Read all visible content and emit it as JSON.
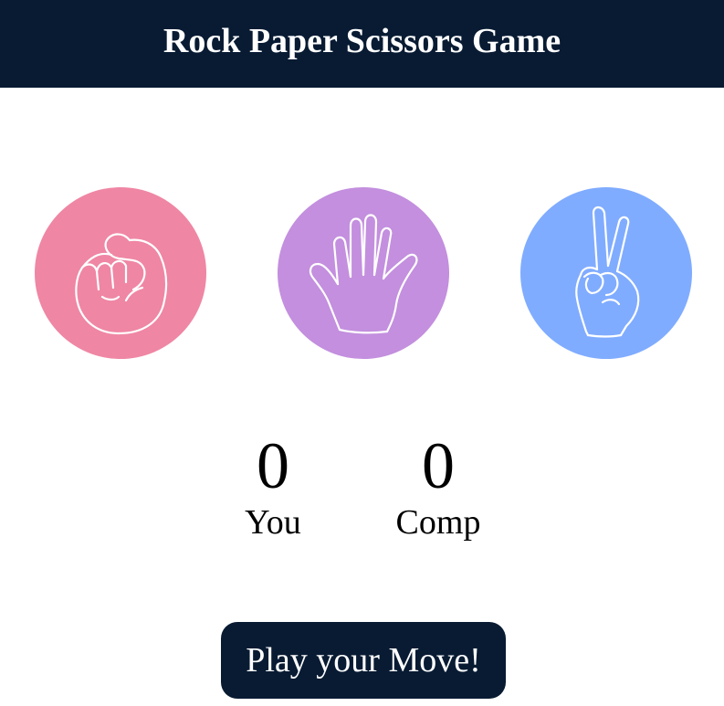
{
  "header": {
    "title": "Rock Paper Scissors Game"
  },
  "choices": [
    {
      "id": "rock",
      "icon": "fist-icon",
      "color": "#ef86a4"
    },
    {
      "id": "paper",
      "icon": "open-hand-icon",
      "color": "#c38fde"
    },
    {
      "id": "scissors",
      "icon": "peace-sign-icon",
      "color": "#80acff"
    }
  ],
  "scoreboard": {
    "user_score": "0",
    "user_label": "You",
    "comp_score": "0",
    "comp_label": "Comp"
  },
  "message": {
    "text": "Play your Move!",
    "background": "#081b33"
  }
}
